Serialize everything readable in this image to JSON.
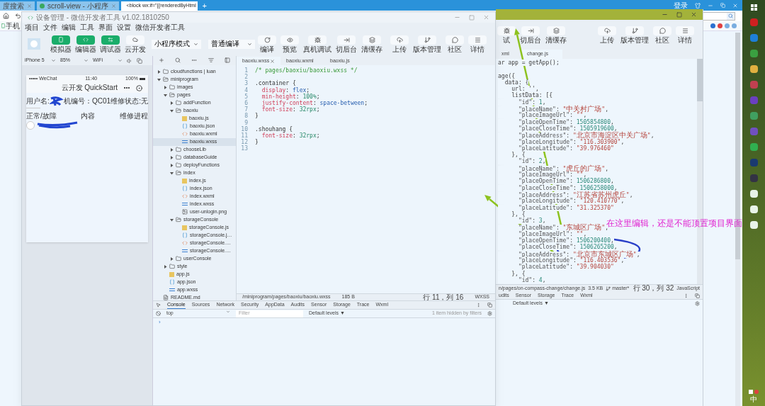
{
  "browser": {
    "tabs": [
      {
        "label": "度搜索",
        "selected": false
      },
      {
        "label": "scroll-view - 小程序",
        "selected": false
      },
      {
        "label": "<block wx:if=\"{{renderedByHtml",
        "selected": true
      }
    ],
    "new_tab": "+",
    "login": "登录",
    "bookmark": "手机"
  },
  "devtools": {
    "title": "设备管理 - 微信开发者工具 v1.02.1810250",
    "menu": [
      "项目",
      "文件",
      "编辑",
      "工具",
      "界面",
      "设置",
      "微信开发者工具"
    ],
    "mode_buttons": [
      {
        "label": "模拟器",
        "on": true
      },
      {
        "label": "编辑器",
        "on": true
      },
      {
        "label": "调试器",
        "on": true
      },
      {
        "label": "云开发",
        "on": false
      }
    ],
    "mode_select": "小程序模式",
    "compile_select": "普通编译",
    "actions": [
      "编译",
      "预览",
      "真机调试",
      "切后台",
      "清缓存"
    ],
    "right_actions": [
      "上传",
      "版本管理",
      "社区",
      "详情"
    ],
    "simulator": {
      "device": "iPhone 5",
      "zoom": "85%",
      "network": "WiFi",
      "phone": {
        "carrier": "••••• WeChat",
        "time": "11:40",
        "battery": "100%",
        "nav_title": "云开发 QuickStart",
        "info": [
          "用户名:",
          "机编号：QC01",
          "维修状态:",
          "无"
        ],
        "headers": [
          "正常/故障",
          "内容",
          "维修进程"
        ],
        "row_switch": {
          "on": false
        }
      }
    },
    "file_tree": [
      {
        "name": "cloudfunctions | luan",
        "kind": "folder",
        "expanded": false,
        "selected": false
      },
      {
        "name": "miniprogram",
        "kind": "folder",
        "expanded": true,
        "selected": false,
        "children": [
          {
            "name": "images",
            "kind": "folder",
            "expanded": false,
            "selected": false
          },
          {
            "name": "pages",
            "kind": "folder",
            "expanded": true,
            "selected": false,
            "children": [
              {
                "name": "addFunction",
                "kind": "folder",
                "expanded": false,
                "selected": false
              },
              {
                "name": "baoxiu",
                "kind": "folder",
                "expanded": true,
                "selected": false,
                "children": [
                  {
                    "name": "baoxiu.js",
                    "kind": "js",
                    "selected": false
                  },
                  {
                    "name": "baoxiu.json",
                    "kind": "json",
                    "selected": false
                  },
                  {
                    "name": "baoxiu.wxml",
                    "kind": "wxml",
                    "selected": false
                  },
                  {
                    "name": "baoxiu.wxss",
                    "kind": "wxss",
                    "selected": true
                  }
                ]
              },
              {
                "name": "chooseLib",
                "kind": "folder",
                "expanded": false,
                "selected": false
              },
              {
                "name": "databaseGuide",
                "kind": "folder",
                "expanded": false,
                "selected": false
              },
              {
                "name": "deployFunctions",
                "kind": "folder",
                "expanded": false,
                "selected": false
              },
              {
                "name": "index",
                "kind": "folder",
                "expanded": true,
                "selected": false,
                "children": [
                  {
                    "name": "index.js",
                    "kind": "js",
                    "selected": false
                  },
                  {
                    "name": "index.json",
                    "kind": "json",
                    "selected": false
                  },
                  {
                    "name": "index.wxml",
                    "kind": "wxml",
                    "selected": false
                  },
                  {
                    "name": "index.wxss",
                    "kind": "wxss",
                    "selected": false
                  },
                  {
                    "name": "user-unlogin.png",
                    "kind": "png",
                    "selected": false
                  }
                ]
              },
              {
                "name": "storageConsole",
                "kind": "folder",
                "expanded": true,
                "selected": false,
                "children": [
                  {
                    "name": "storageConsole.js",
                    "kind": "js",
                    "selected": false
                  },
                  {
                    "name": "storageConsole.j…",
                    "kind": "json",
                    "selected": false
                  },
                  {
                    "name": "storageConsole.…",
                    "kind": "wxml",
                    "selected": false
                  },
                  {
                    "name": "storageConsole.…",
                    "kind": "wxss",
                    "selected": false
                  }
                ]
              },
              {
                "name": "userConsole",
                "kind": "folder",
                "expanded": false,
                "selected": false
              }
            ]
          },
          {
            "name": "style",
            "kind": "folder",
            "expanded": false,
            "selected": false
          },
          {
            "name": "app.js",
            "kind": "js",
            "selected": false
          },
          {
            "name": "app.json",
            "kind": "json",
            "selected": false
          },
          {
            "name": "app.wxss",
            "kind": "wxss",
            "selected": false
          }
        ]
      },
      {
        "name": "README.md",
        "kind": "md",
        "selected": false
      }
    ],
    "editor": {
      "tabs": [
        {
          "label": "baoxiu.wxss",
          "selected": true
        },
        {
          "label": "baoxiu.wxml",
          "selected": false
        },
        {
          "label": "baoxiu.js",
          "selected": false
        }
      ],
      "lines": [
        {
          "n": "1",
          "tokens": [
            {
              "kind": "comment",
              "text": "/* pages/baoxiu/baoxiu.wxss */"
            }
          ]
        },
        {
          "n": "2"
        },
        {
          "n": "3",
          "tokens": [
            {
              "kind": "plain",
              "text": ".container {"
            }
          ]
        },
        {
          "n": "4",
          "tokens": [
            {
              "kind": "prop",
              "text": "  display"
            },
            {
              "kind": "plain",
              "text": ": "
            },
            {
              "kind": "value",
              "text": "flex"
            },
            {
              "kind": "plain",
              "text": ";"
            }
          ]
        },
        {
          "n": "5",
          "tokens": [
            {
              "kind": "prop",
              "text": "  min-height"
            },
            {
              "kind": "plain",
              "text": ": "
            },
            {
              "kind": "number",
              "text": "100%"
            },
            {
              "kind": "plain",
              "text": ";"
            }
          ]
        },
        {
          "n": "6",
          "tokens": [
            {
              "kind": "prop",
              "text": "  justify-content"
            },
            {
              "kind": "plain",
              "text": ": "
            },
            {
              "kind": "value",
              "text": "space-between"
            },
            {
              "kind": "plain",
              "text": ";"
            }
          ]
        },
        {
          "n": "7",
          "tokens": [
            {
              "kind": "prop",
              "text": "  font-size"
            },
            {
              "kind": "plain",
              "text": ": "
            },
            {
              "kind": "number",
              "text": "32rpx"
            },
            {
              "kind": "plain",
              "text": ";"
            }
          ]
        },
        {
          "n": "8",
          "tokens": [
            {
              "kind": "plain",
              "text": "}"
            }
          ]
        },
        {
          "n": "9"
        },
        {
          "n": "10",
          "tokens": [
            {
              "kind": "plain",
              "text": ".shouhang {"
            }
          ]
        },
        {
          "n": "11",
          "tokens": [
            {
              "kind": "prop",
              "text": "  font-size"
            },
            {
              "kind": "plain",
              "text": ": "
            },
            {
              "kind": "number",
              "text": "32rpx"
            },
            {
              "kind": "plain",
              "text": ";"
            }
          ]
        },
        {
          "n": "12",
          "tokens": [
            {
              "kind": "plain",
              "text": "}"
            }
          ]
        },
        {
          "n": "13"
        }
      ],
      "status": {
        "path": "/miniprogram/pages/baoxiu/baoxiu.wxss",
        "size": "185 B",
        "position": "行 11，列 16",
        "language": "WXSS"
      }
    },
    "console": {
      "tabs": [
        {
          "label": "Console",
          "selected": true
        },
        {
          "label": "Sources",
          "selected": false
        },
        {
          "label": "Network",
          "selected": false
        },
        {
          "label": "Security",
          "selected": false
        },
        {
          "label": "AppData",
          "selected": false
        },
        {
          "label": "Audits",
          "selected": false
        },
        {
          "label": "Sensor",
          "selected": false
        },
        {
          "label": "Storage",
          "selected": false
        },
        {
          "label": "Trace",
          "selected": false
        },
        {
          "label": "Wxml",
          "selected": false
        }
      ],
      "context": "top",
      "filter_placeholder": "Filter",
      "levels": "Default levels ▼",
      "hidden_note": "1 item hidden by filters",
      "prompt": "›"
    }
  },
  "back_window": {
    "actions": [
      "试",
      "切后台",
      "清缓存"
    ],
    "right_actions": [
      "上传",
      "版本管理",
      "社区",
      "详情"
    ],
    "tabs": [
      {
        "label": "xml",
        "selected": false
      },
      {
        "label": "change.js",
        "selected": true
      }
    ],
    "lines": [
      {
        "text": "ar app = getApp();"
      },
      {
        "text": "age({",
        "gap_before": true
      },
      {
        "text": "  data: {"
      },
      {
        "text": "    url: '',"
      },
      {
        "text": "    listData: [{"
      },
      {
        "text": "      \"id\": 1,"
      },
      {
        "text": "      \"placeName\": \"中关村广场\","
      },
      {
        "text": "      \"placeImageUrl\": \"\","
      },
      {
        "text": "      \"placeOpenTime\": 1505854800,"
      },
      {
        "text": "      \"placeCloseTime\": 1505919600,"
      },
      {
        "text": "      \"placeAddress\": \"北京市海淀区中关广场\","
      },
      {
        "text": "      \"placeLongitude\": \"116.303900\","
      },
      {
        "text": "      \"placeLatitude\": \"39.976460\""
      },
      {
        "text": "    }, {"
      },
      {
        "text": "      \"id\": 2,"
      },
      {
        "text": "      \"placeName\": \"虎丘的广场\","
      },
      {
        "text": "      \"placeImageUrl\": \"\","
      },
      {
        "text": "      \"placeOpenTime\": 1506286800,"
      },
      {
        "text": "      \"placeCloseTime\": 1506258000,"
      },
      {
        "text": "      \"placeAddress\": \"江苏省苏州虎丘\","
      },
      {
        "text": "      \"placeLongitude\": \"120.410770\","
      },
      {
        "text": "      \"placeLatitude\": \"31.325370\""
      },
      {
        "text": "    }, {"
      },
      {
        "text": "      \"id\": 3,"
      },
      {
        "text": "      \"placeName\": \"东城区广场\","
      },
      {
        "text": "      \"placeImageUrl\": \"\","
      },
      {
        "text": "      \"placeOpenTime\": 1506200400,"
      },
      {
        "text": "      \"placeCloseTime\": 1506265200,"
      },
      {
        "text": "      \"placeAddress\": \"北京市东城区广场\","
      },
      {
        "text": "      \"placeLongitude\": \"116.403536\","
      },
      {
        "text": "      \"placeLatitude\": \"39.904030\""
      },
      {
        "text": "    }, {"
      },
      {
        "text": "      \"id\": 4,"
      }
    ],
    "status": {
      "path": "n/pages/on-compass-change/change.js",
      "size": "3.5 KB",
      "branch": "master*",
      "position": "行 30，列 32",
      "language": "JavaScript"
    },
    "console_tabs": [
      {
        "label": "udits",
        "selected": false
      },
      {
        "label": "Sensor",
        "selected": false
      },
      {
        "label": "Storage",
        "selected": false
      },
      {
        "label": "Trace",
        "selected": false
      },
      {
        "label": "Wxml",
        "selected": false
      }
    ],
    "levels": "Default levels ▼"
  },
  "annotation": {
    "note": "在这里编辑，还是不能顶置项目界面"
  },
  "taskbar": {
    "ime": "中"
  }
}
